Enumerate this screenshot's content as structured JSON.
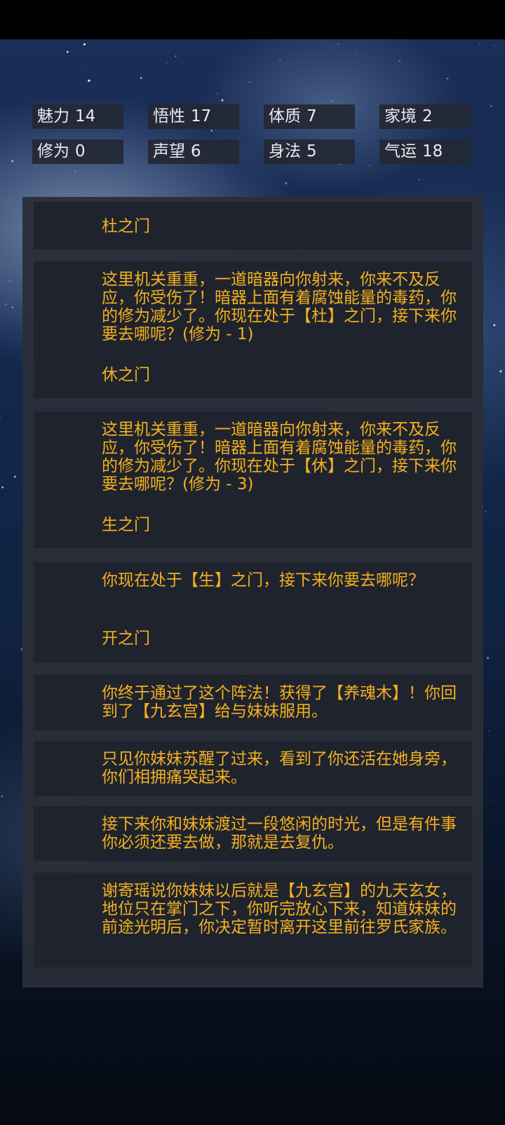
{
  "stats": [
    {
      "label": "魅力",
      "value": "14"
    },
    {
      "label": "悟性",
      "value": "17"
    },
    {
      "label": "体质",
      "value": "7"
    },
    {
      "label": "家境",
      "value": "2"
    },
    {
      "label": "修为",
      "value": "0"
    },
    {
      "label": "声望",
      "value": "6"
    },
    {
      "label": "身法",
      "value": "5"
    },
    {
      "label": "气运",
      "value": "18"
    }
  ],
  "log": [
    {
      "choice": "杜之门"
    },
    {
      "text": "这里机关重重，一道暗器向你射来，你来不及反应，你受伤了！暗器上面有着腐蚀能量的毒药，你的修为减少了。你现在处于【杜】之门，接下来你要去哪呢？(修为 - 1)",
      "choice": "休之门"
    },
    {
      "text": "这里机关重重，一道暗器向你射来，你来不及反应，你受伤了！暗器上面有着腐蚀能量的毒药，你的修为减少了。你现在处于【休】之门，接下来你要去哪呢？(修为 - 3)",
      "choice": "生之门"
    },
    {
      "text": "你现在处于【生】之门，接下来你要去哪呢？",
      "choice": "开之门"
    },
    {
      "text": "你终于通过了这个阵法！获得了【养魂木】！你回到了【九玄宫】给与妹妹服用。"
    },
    {
      "text": "只见你妹妹苏醒了过来，看到了你还活在她身旁，你们相拥痛哭起来。"
    },
    {
      "text": "接下来你和妹妹渡过一段悠闲的时光，但是有件事你必须还要去做，那就是去复仇。"
    },
    {
      "text": "谢寄瑶说你妹妹以后就是【九玄宫】的九天玄女，地位只在掌门之下，你听完放心下来，知道妹妹的前途光明后，你决定暂时离开这里前往罗氏家族。"
    }
  ]
}
